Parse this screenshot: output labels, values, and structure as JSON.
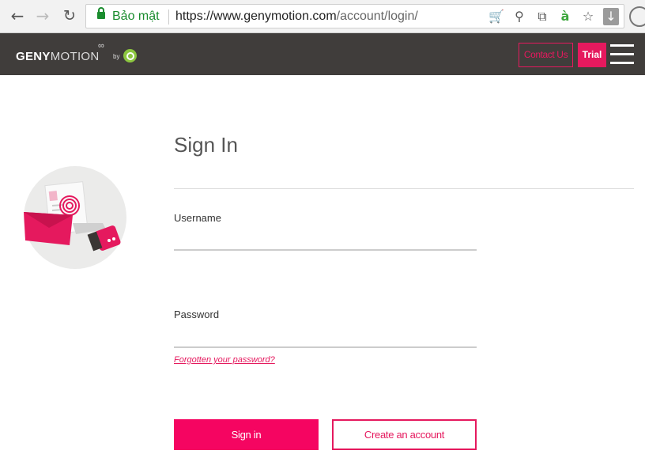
{
  "browser": {
    "back_icon": "←",
    "forward_icon": "→",
    "reload_icon": "↻",
    "secure_label": "Bảo mật",
    "url_host": "https://www.genymotion.com",
    "url_path": "/account/login/",
    "icons": [
      "cart-icon",
      "zoom-icon",
      "translate-icon",
      "accent-icon",
      "star-icon",
      "download-icon"
    ],
    "icon_glyphs": {
      "cart": "🛒",
      "zoom": "⚲",
      "translate": "⧉",
      "accent": "à",
      "star": "☆",
      "download": "↓"
    }
  },
  "header": {
    "logo_bold": "GENY",
    "logo_light": "MOTION",
    "logo_infinity": "∞",
    "by_text": "by",
    "contact_label": "Contact Us",
    "trial_label": "Trial"
  },
  "main": {
    "title": "Sign In",
    "username_label": "Username",
    "password_label": "Password",
    "forgot_link": "Forgotten your password?",
    "signin_label": "Sign in",
    "create_label": "Create an account"
  },
  "colors": {
    "accent": "#e5195e",
    "header_bg": "#403d3b",
    "secure_green": "#1a8c2e",
    "brand_green": "#8cc63f"
  }
}
